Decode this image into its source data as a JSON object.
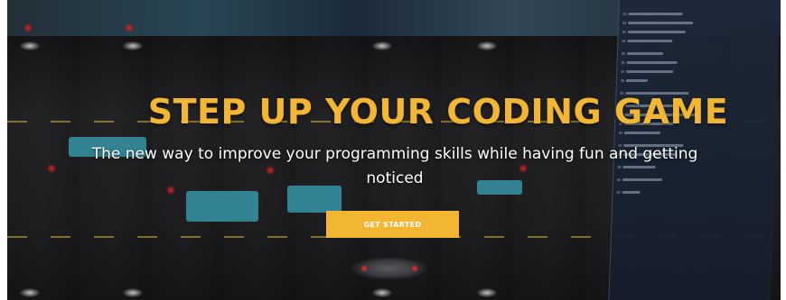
{
  "hero": {
    "headline": "STEP UP YOUR CODING GAME",
    "subheadline": "The new way to improve your programming skills while having fun and getting noticed",
    "cta_label": "GET STARTED"
  },
  "colors": {
    "accent": "#f2b632",
    "headline_text": "#f2b632",
    "body_text": "#ffffff",
    "background": "#1f1f22"
  }
}
